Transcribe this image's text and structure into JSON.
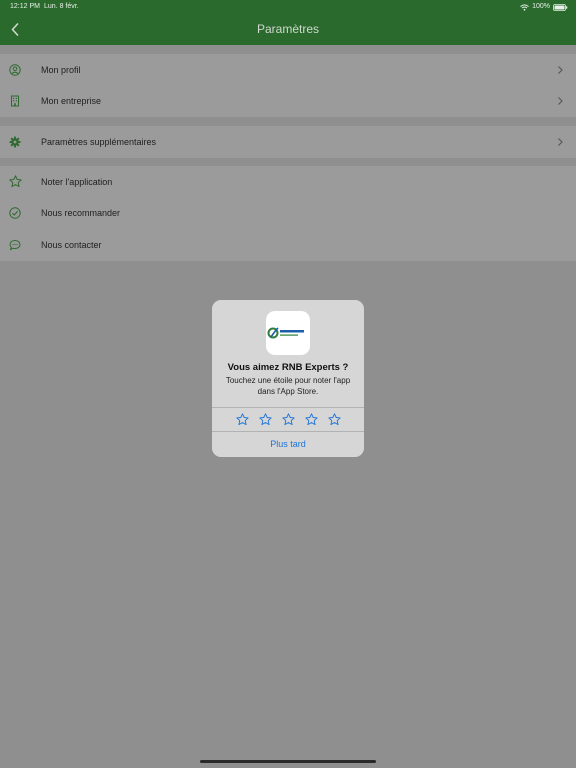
{
  "status": {
    "time": "12:12 PM",
    "date": "Lun. 8 févr.",
    "battery": "100%"
  },
  "nav": {
    "title": "Paramètres"
  },
  "groups": {
    "account": [
      {
        "label": "Mon profil",
        "icon": "user-circle-icon"
      },
      {
        "label": "Mon entreprise",
        "icon": "building-icon"
      }
    ],
    "settings": [
      {
        "label": "Paramètres supplémentaires",
        "icon": "gear-icon"
      }
    ],
    "app": [
      {
        "label": "Noter l'application",
        "icon": "star-icon"
      },
      {
        "label": "Nous recommander",
        "icon": "check-circle-icon"
      },
      {
        "label": "Nous contacter",
        "icon": "chat-bubble-icon"
      }
    ]
  },
  "dialog": {
    "title": "Vous aimez RNB Experts ?",
    "message": "Touchez une étoile pour noter l'app dans l'App Store.",
    "rating_stars": 5,
    "later_label": "Plus tard",
    "logo_text": "RNB EXPERTS",
    "logo_subtext": "conseil et expertise"
  },
  "colors": {
    "accent_green": "#2b6a2d",
    "icon_green": "#2e6a30",
    "link_blue": "#1a73d9"
  }
}
